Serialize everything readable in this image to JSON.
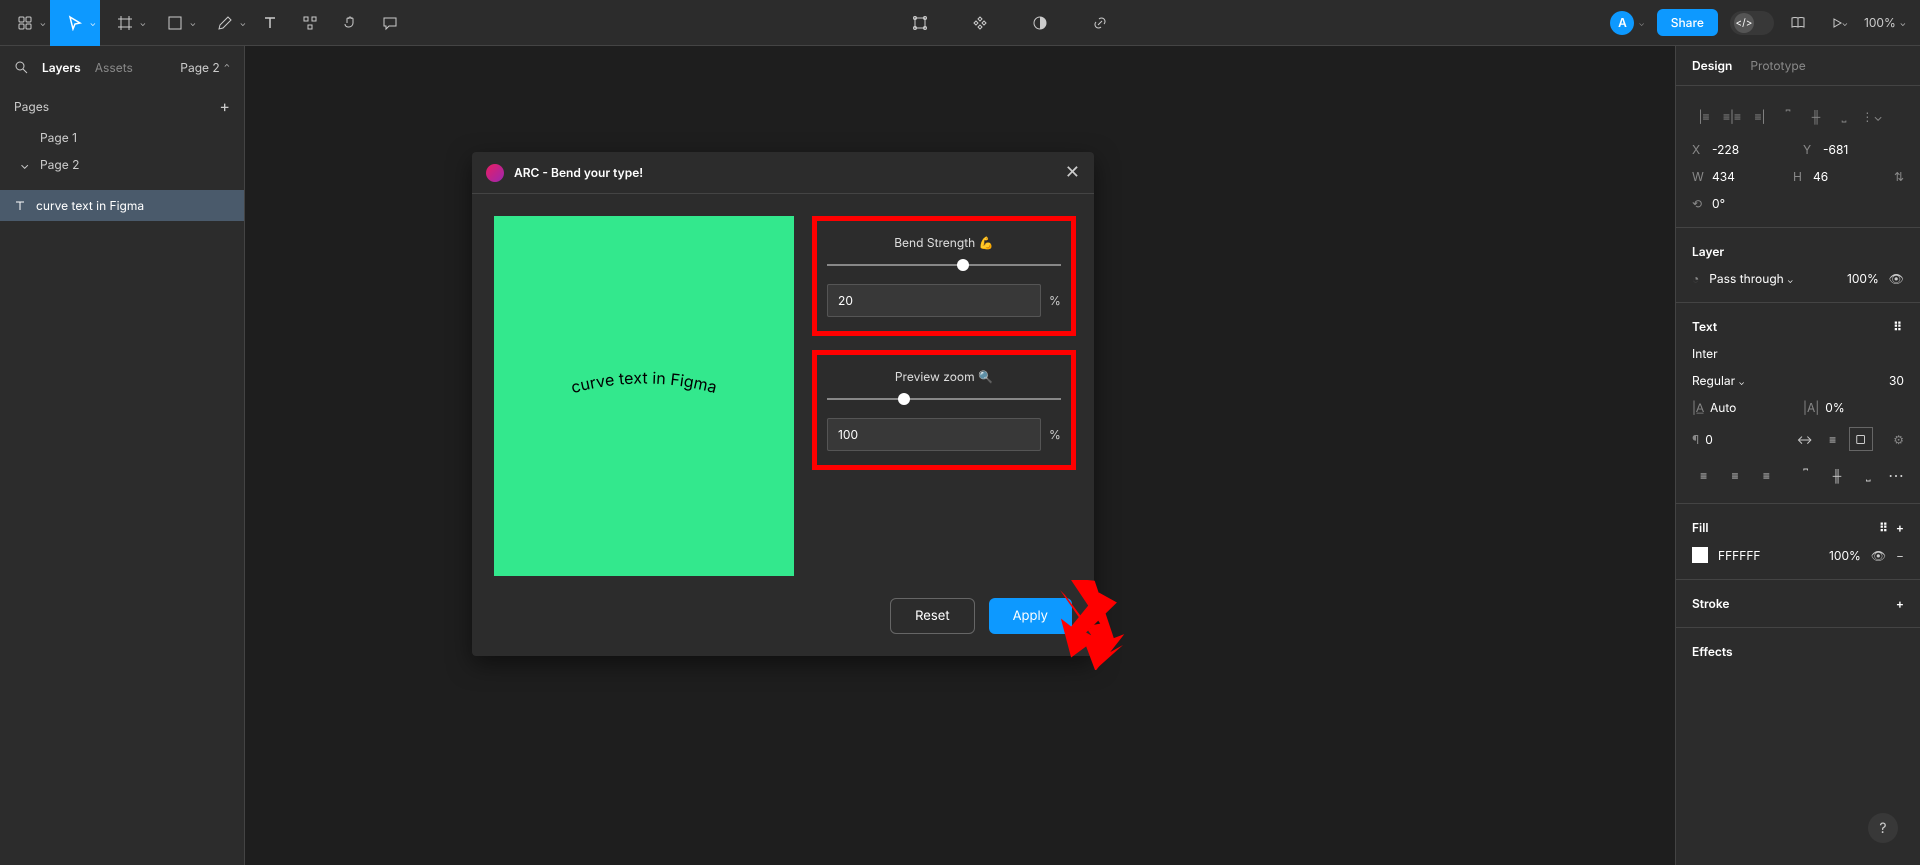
{
  "toolbar": {
    "avatar_letter": "A",
    "share_label": "Share",
    "zoom": "100%"
  },
  "left_panel": {
    "tabs": {
      "layers": "Layers",
      "assets": "Assets"
    },
    "page_selector": "Page 2",
    "pages_header": "Pages",
    "pages": [
      "Page 1",
      "Page 2"
    ],
    "layer_name": "curve text in Figma"
  },
  "plugin": {
    "title": "ARC - Bend your type!",
    "preview_text": "curve text in Figma",
    "bend": {
      "label": "Bend Strength 💪",
      "value": "20",
      "unit": "%",
      "thumb_pct": 58
    },
    "zoom": {
      "label": "Preview zoom 🔍",
      "value": "100",
      "unit": "%",
      "thumb_pct": 33
    },
    "reset": "Reset",
    "apply": "Apply"
  },
  "right_panel": {
    "tabs": {
      "design": "Design",
      "prototype": "Prototype"
    },
    "transform": {
      "x_label": "X",
      "x": "-228",
      "y_label": "Y",
      "y": "-681",
      "w_label": "W",
      "w": "434",
      "h_label": "H",
      "h": "46",
      "rotation": "0°"
    },
    "layer": {
      "title": "Layer",
      "blend": "Pass through",
      "opacity": "100%"
    },
    "text": {
      "title": "Text",
      "font": "Inter",
      "weight": "Regular",
      "size": "30",
      "line_height": "Auto",
      "letter_spacing": "0%",
      "paragraph": "0"
    },
    "fill": {
      "title": "Fill",
      "hex": "FFFFFF",
      "opacity": "100%"
    },
    "stroke": {
      "title": "Stroke"
    },
    "effects": {
      "title": "Effects"
    }
  }
}
